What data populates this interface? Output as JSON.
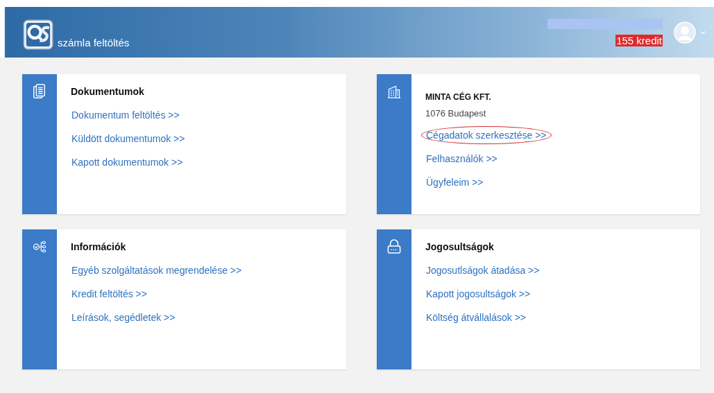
{
  "header": {
    "app_name": "számla feltöltés",
    "credit": "155 kredit"
  },
  "cards": [
    {
      "kind": "documents",
      "title": "Dokumentumok",
      "links": [
        {
          "label": "Dokumentum feltöltés >>",
          "highlighted": false
        },
        {
          "label": "Küldött dokumentumok >>",
          "highlighted": false
        },
        {
          "label": "Kapott dokumentumok >>",
          "highlighted": false
        }
      ]
    },
    {
      "kind": "company",
      "title": "MINTA CÉG KFT.",
      "subtitle": "1076 Budapest",
      "links": [
        {
          "label": "Cégadatok szerkesztése >>",
          "highlighted": true
        },
        {
          "label": "Felhasználók >>",
          "highlighted": false
        },
        {
          "label": "Ügyfeleim >>",
          "highlighted": false
        }
      ]
    },
    {
      "kind": "info",
      "title": "Információk",
      "links": [
        {
          "label": "Egyéb szolgáltatások megrendelése >>",
          "highlighted": false
        },
        {
          "label": "Kredit feltöltés >>",
          "highlighted": false
        },
        {
          "label": "Leírások, segédletek >>",
          "highlighted": false
        }
      ]
    },
    {
      "kind": "permissions",
      "title": "Jogosultságok",
      "links": [
        {
          "label": "Jogosutlságok átadása >>",
          "highlighted": false
        },
        {
          "label": "Kapott jogosultságok >>",
          "highlighted": false
        },
        {
          "label": "Költség átvállalások >>",
          "highlighted": false
        }
      ]
    }
  ]
}
